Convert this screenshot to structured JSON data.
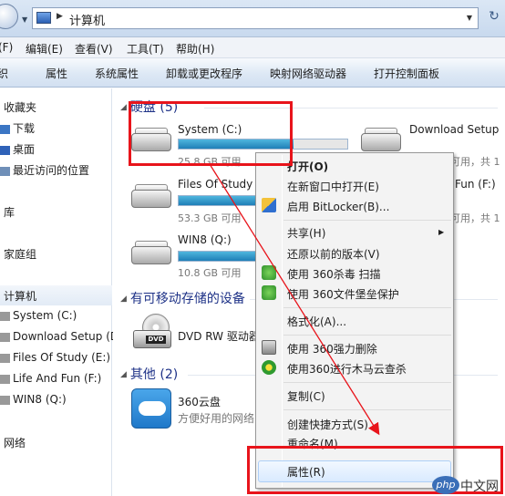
{
  "address": {
    "path": "计算机"
  },
  "menubar": [
    "(F)",
    "编辑(E)",
    "查看(V)",
    "工具(T)",
    "帮助(H)"
  ],
  "toolbar": [
    "织",
    "属性",
    "系统属性",
    "卸载或更改程序",
    "映射网络驱动器",
    "打开控制面板"
  ],
  "nav": {
    "items": [
      "收藏夹",
      "下载",
      "桌面",
      "最近访问的位置",
      "库",
      "家庭组",
      "计算机",
      "System (C:)",
      "Download Setup (D:)",
      "Files Of Study (E:)",
      "Life And Fun (F:)",
      "WIN8 (Q:)",
      "网络"
    ]
  },
  "content": {
    "groups": [
      "硬盘 (5)",
      "有可移动存储的设备",
      "其他 (2)"
    ],
    "drives": [
      {
        "name": "System (C:)",
        "free": "25.8 GB 可用",
        "used_fraction": 0.68
      },
      {
        "name": "Files Of Study",
        "free": "53.3 GB 可用",
        "used_fraction": 0.55
      },
      {
        "name": "WIN8 (Q:)",
        "free": "10.8 GB 可用",
        "used_fraction": 0.8
      },
      {
        "name": "Download Setup",
        "free": "可用，共 1"
      },
      {
        "name": "Fun (F:)",
        "free": "可用，共 1"
      }
    ],
    "dvd": {
      "name": "DVD RW 驱动器"
    },
    "cloud": {
      "name": "360云盘",
      "desc": "方便好用的网络"
    }
  },
  "context_menu": {
    "items": [
      "打开(O)",
      "在新窗口中打开(E)",
      "启用 BitLocker(B)...",
      "共享(H)",
      "还原以前的版本(V)",
      "使用 360杀毒 扫描",
      "使用 360文件堡垒保护",
      "格式化(A)...",
      "使用 360强力删除",
      "使用360进行木马云查杀",
      "复制(C)",
      "创建快捷方式(S)",
      "重命名(M)",
      "属性(R)"
    ]
  },
  "watermark": {
    "logo": "php",
    "text": "中文网"
  },
  "colors": {
    "annotation": "#e8141b",
    "progress": "#1f7fb7"
  }
}
